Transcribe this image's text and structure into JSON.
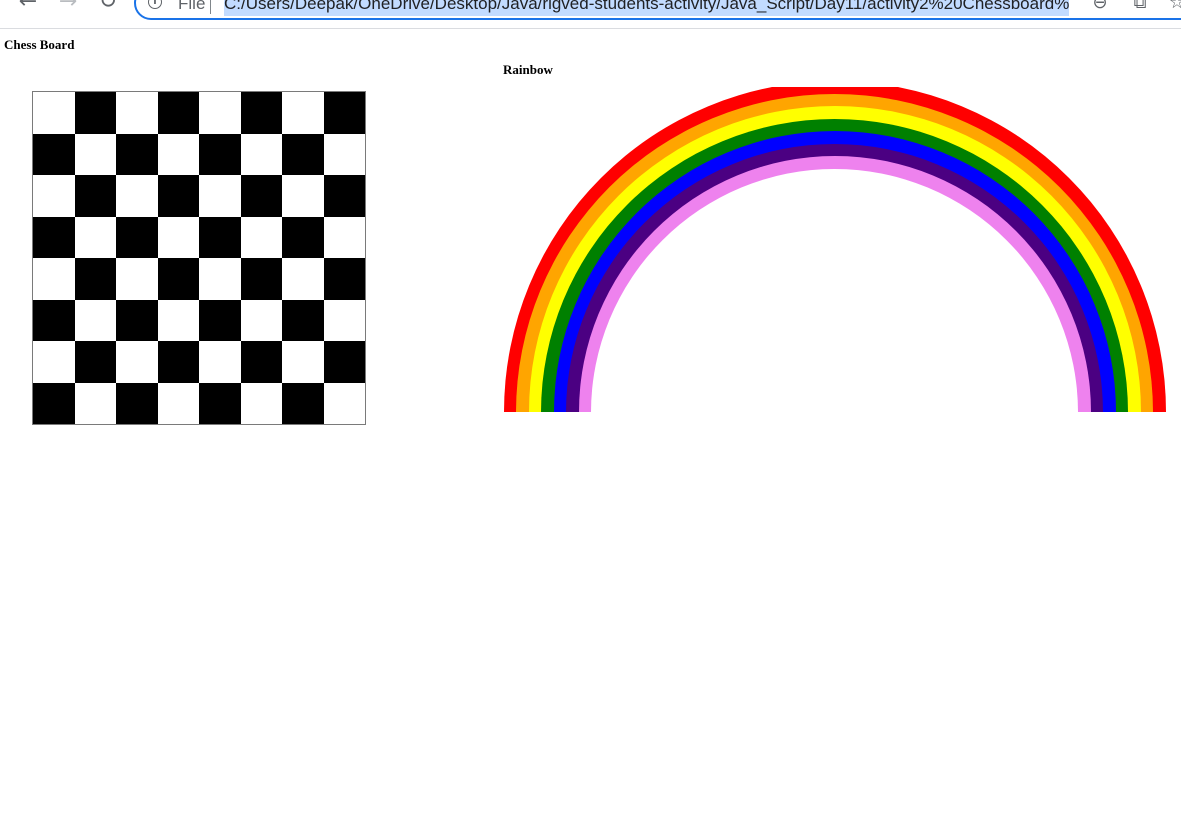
{
  "browser": {
    "back_icon": "arrow-left-icon",
    "forward_icon": "arrow-right-icon",
    "reload_icon": "reload-icon",
    "scheme_label": "File",
    "url": "C:/Users/Deepak/OneDrive/Desktop/Java/rigved-students-activity/Java_Script/Day11/activity2%20Chessboard%",
    "zoom_icon": "zoom-out-icon",
    "share_icon": "share-icon",
    "bookmark_icon": "star-icon"
  },
  "page": {
    "chess_heading": "Chess Board",
    "rainbow_heading": "Rainbow"
  },
  "chessboard": {
    "rows": 8,
    "columns": 8,
    "top_left_color": "#ffffff",
    "light_color": "#ffffff",
    "dark_color": "#000000",
    "border_color": "#7a7a7a"
  },
  "rainbow": {
    "bands": [
      "#ff0000",
      "#ffa500",
      "#ffff00",
      "#008000",
      "#0000ff",
      "#4b0082",
      "#ee82ee",
      "#ffffff"
    ]
  }
}
